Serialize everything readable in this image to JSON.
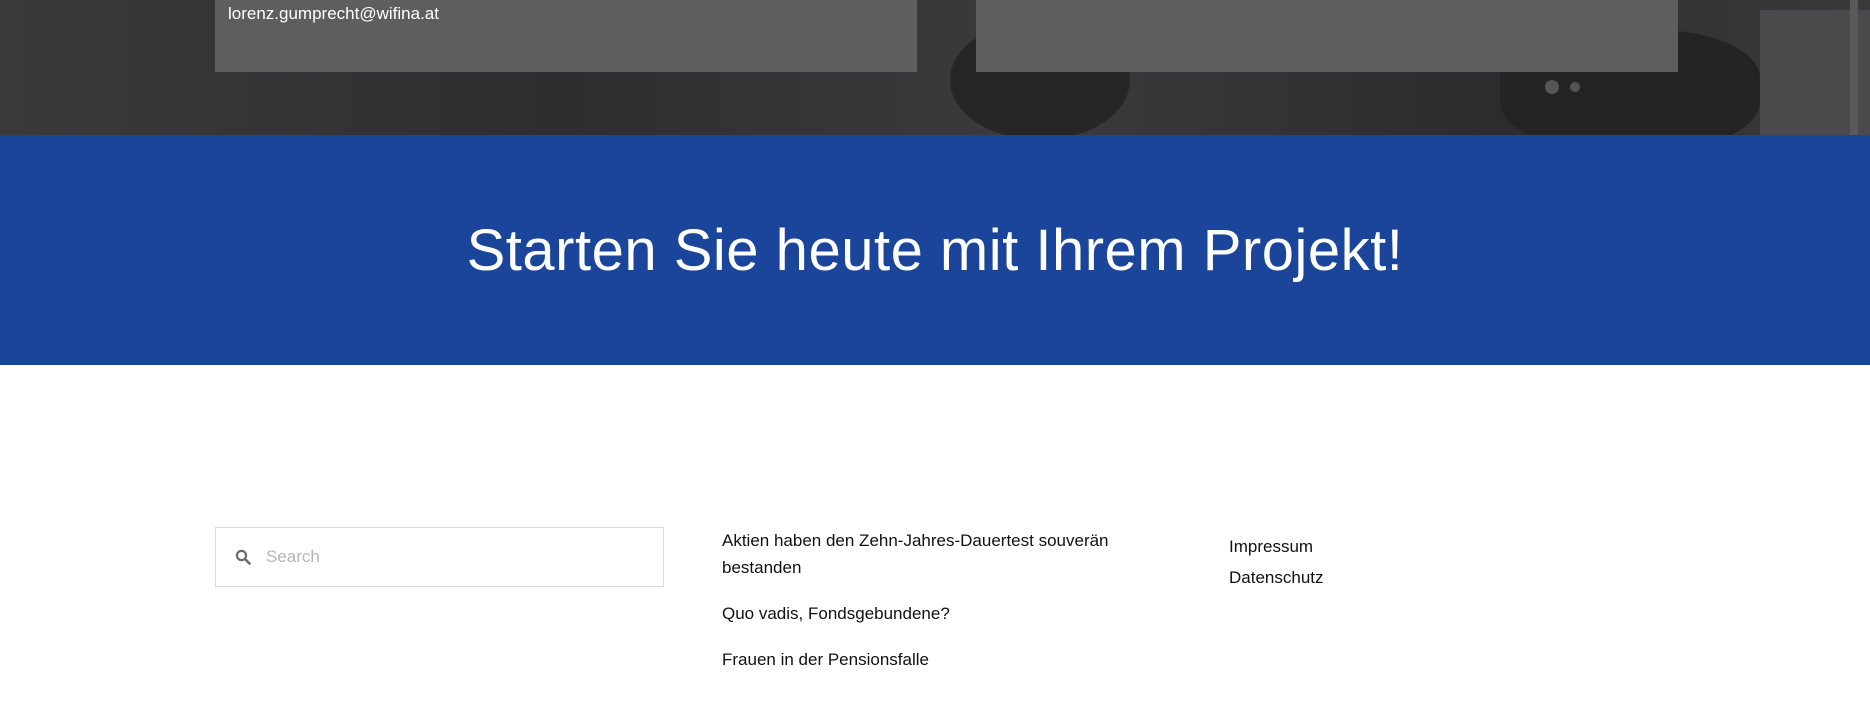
{
  "contact": {
    "email": "lorenz.gumprecht@wifina.at"
  },
  "cta": {
    "title": "Starten Sie heute mit Ihrem Projekt!"
  },
  "search": {
    "placeholder": "Search",
    "icon": "search-icon"
  },
  "recent_posts": [
    {
      "label": "Aktien haben den Zehn-Jahres-Dauertest souverän bestanden"
    },
    {
      "label": "Quo vadis, Fondsgebundene?"
    },
    {
      "label": "Frauen in der Pensionsfalle"
    }
  ],
  "legal_links": [
    {
      "label": "Impressum"
    },
    {
      "label": "Datenschutz"
    }
  ],
  "colors": {
    "cta_background": "#1b459b",
    "info_box_background": "#5e5e5e",
    "hero_background": "#333335"
  }
}
